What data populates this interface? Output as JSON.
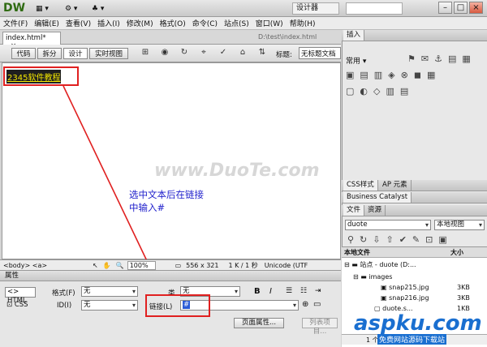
{
  "app": {
    "logo": "DW",
    "workspace": "设计器",
    "min": "–",
    "max": "□",
    "close": "×"
  },
  "menu": [
    "文件(F)",
    "编辑(E)",
    "查看(V)",
    "插入(I)",
    "修改(M)",
    "格式(O)",
    "命令(C)",
    "站点(S)",
    "窗口(W)",
    "帮助(H)"
  ],
  "document": {
    "tab": "index.html*",
    "tab_close": "×",
    "path": "D:\\test\\index.html",
    "view_buttons": [
      "代码",
      "拆分",
      "设计",
      "实时视图"
    ],
    "title_label": "标题:",
    "title_value": "无标题文档",
    "selected_text": "2345软件教程",
    "annotation_line1": "选中文本后在链接",
    "annotation_line2": "中输入#",
    "watermark": "www.DuoTe.com"
  },
  "status": {
    "tags": "<body> <a>",
    "zoom": "100%",
    "size": "556 x 321",
    "filesize": "1 K / 1 秒",
    "encoding": "Unicode (UTF"
  },
  "properties": {
    "title": "属性",
    "html_btn": "HTML",
    "css_btn": "CSS",
    "format_label": "格式(F)",
    "format_value": "无",
    "class_label": "类",
    "class_value": "无",
    "id_label": "ID(I)",
    "id_value": "无",
    "link_label": "链接(L)",
    "link_value": "#",
    "bold": "B",
    "italic": "I",
    "page_props": "页面属性...",
    "list_item": "列表项目..."
  },
  "insert_panel": {
    "title": "插入",
    "category": "常用"
  },
  "css_panel": {
    "tabs": [
      "CSS样式",
      "AP 元素"
    ]
  },
  "bc_panel": {
    "title": "Business Catalyst"
  },
  "files_panel": {
    "tabs": [
      "文件",
      "资源"
    ],
    "site": "duote",
    "view": "本地视图",
    "col_local": "本地文件",
    "col_size": "大小",
    "rows": [
      {
        "name": "站点 - duote (D:...",
        "size": ""
      },
      {
        "name": "images",
        "size": ""
      },
      {
        "name": "snap215.jpg",
        "size": "3KB"
      },
      {
        "name": "snap216.jpg",
        "size": "3KB"
      },
      {
        "name": "duote.s...",
        "size": "1KB"
      }
    ],
    "footer": "1 个本地项目"
  },
  "brand": {
    "aspku": "aspku.com",
    "aspku_sub": "免费网站源码下载站"
  }
}
